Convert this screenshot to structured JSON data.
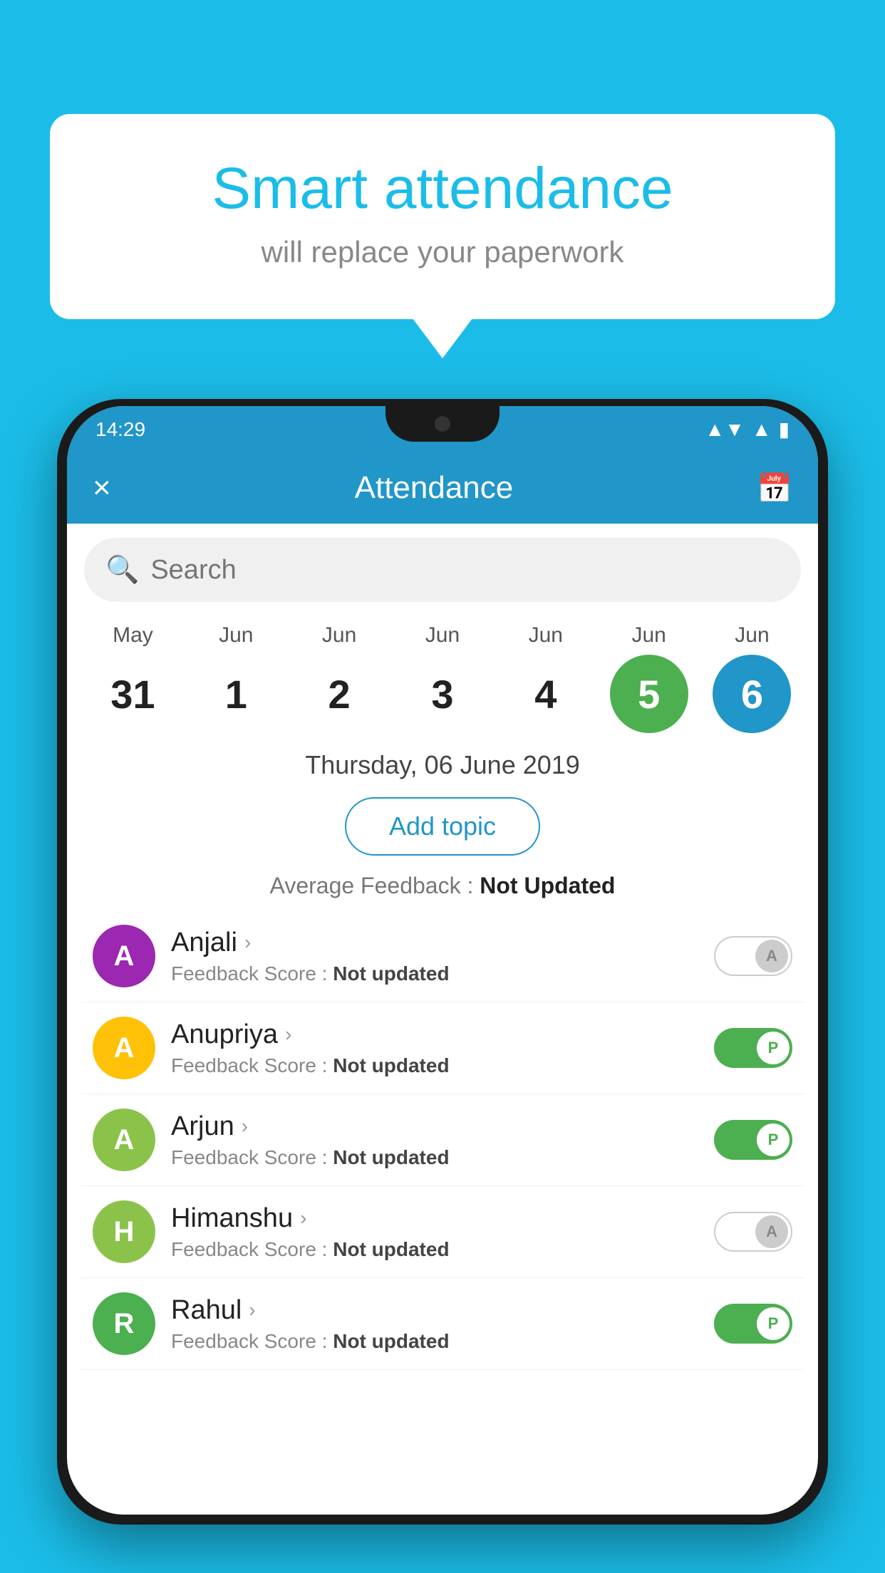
{
  "background_color": "#1BBDE8",
  "speech_bubble": {
    "title": "Smart attendance",
    "subtitle": "will replace your paperwork"
  },
  "status_bar": {
    "time": "14:29",
    "icons": [
      "wifi",
      "signal",
      "battery"
    ]
  },
  "app_bar": {
    "title": "Attendance",
    "close_label": "×",
    "calendar_icon": "📅"
  },
  "search": {
    "placeholder": "Search"
  },
  "calendar": {
    "days": [
      {
        "month": "May",
        "number": "31",
        "state": "normal"
      },
      {
        "month": "Jun",
        "number": "1",
        "state": "normal"
      },
      {
        "month": "Jun",
        "number": "2",
        "state": "normal"
      },
      {
        "month": "Jun",
        "number": "3",
        "state": "normal"
      },
      {
        "month": "Jun",
        "number": "4",
        "state": "normal"
      },
      {
        "month": "Jun",
        "number": "5",
        "state": "today"
      },
      {
        "month": "Jun",
        "number": "6",
        "state": "selected"
      }
    ]
  },
  "selected_date": "Thursday, 06 June 2019",
  "add_topic_label": "Add topic",
  "avg_feedback_label": "Average Feedback : ",
  "avg_feedback_value": "Not Updated",
  "students": [
    {
      "name": "Anjali",
      "initials": "A",
      "avatar_color": "#9C27B0",
      "feedback": "Feedback Score : ",
      "feedback_value": "Not updated",
      "toggle": "off",
      "toggle_label": "A"
    },
    {
      "name": "Anupriya",
      "initials": "A",
      "avatar_color": "#FFC107",
      "feedback": "Feedback Score : ",
      "feedback_value": "Not updated",
      "toggle": "on",
      "toggle_label": "P"
    },
    {
      "name": "Arjun",
      "initials": "A",
      "avatar_color": "#8BC34A",
      "feedback": "Feedback Score : ",
      "feedback_value": "Not updated",
      "toggle": "on",
      "toggle_label": "P"
    },
    {
      "name": "Himanshu",
      "initials": "H",
      "avatar_color": "#8BC34A",
      "feedback": "Feedback Score : ",
      "feedback_value": "Not updated",
      "toggle": "off",
      "toggle_label": "A"
    },
    {
      "name": "Rahul",
      "initials": "R",
      "avatar_color": "#4CAF50",
      "feedback": "Feedback Score : ",
      "feedback_value": "Not updated",
      "toggle": "on",
      "toggle_label": "P"
    }
  ]
}
